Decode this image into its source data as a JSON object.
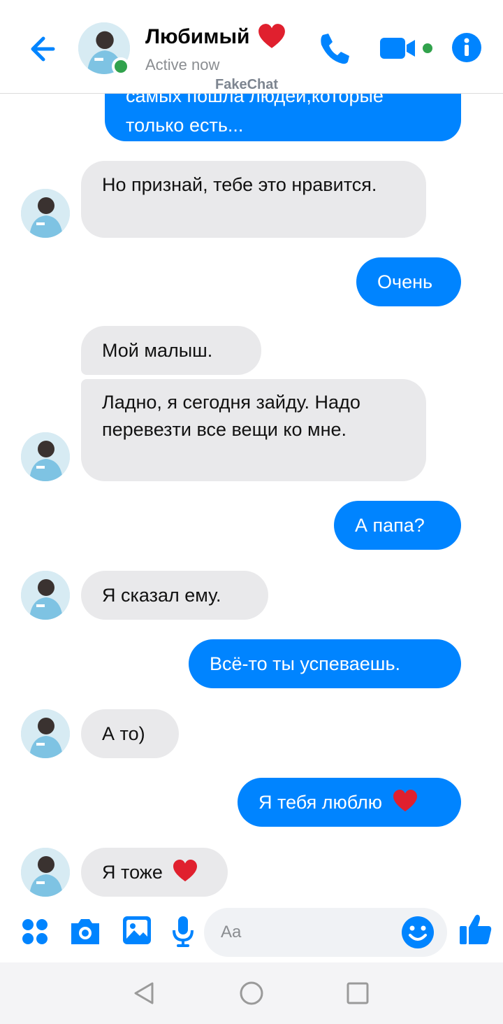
{
  "header": {
    "contact_name": "Любимый",
    "status": "Active now",
    "watermark": "FakeChat"
  },
  "messages": [
    {
      "from": "me",
      "text": "самых пошла людей,которые только есть..."
    },
    {
      "from": "them",
      "text": "Но признай, тебе это нравится."
    },
    {
      "from": "me",
      "text": "Очень"
    },
    {
      "from": "them",
      "text": "Мой малыш."
    },
    {
      "from": "them",
      "text": "Ладно, я сегодня зайду. Надо перевезти все вещи ко мне."
    },
    {
      "from": "me",
      "text": "А папа?"
    },
    {
      "from": "them",
      "text": "Я сказал ему."
    },
    {
      "from": "me",
      "text": "Всё-то ты успеваешь."
    },
    {
      "from": "them",
      "text": "А то)"
    },
    {
      "from": "me",
      "text": "Я тебя люблю",
      "emoji": "red-heart"
    },
    {
      "from": "them",
      "text": "Я тоже",
      "emoji": "red-heart"
    }
  ],
  "composer": {
    "placeholder": "Aa"
  },
  "colors": {
    "accent": "#0084ff",
    "incoming_bubble": "#e9e9eb",
    "online": "#31a24c",
    "heart": "#e0202e"
  },
  "icons": [
    "back-arrow-icon",
    "phone-icon",
    "video-camera-icon",
    "info-icon",
    "apps-grid-icon",
    "camera-icon",
    "image-icon",
    "microphone-icon",
    "smiley-icon",
    "thumbs-up-icon"
  ]
}
